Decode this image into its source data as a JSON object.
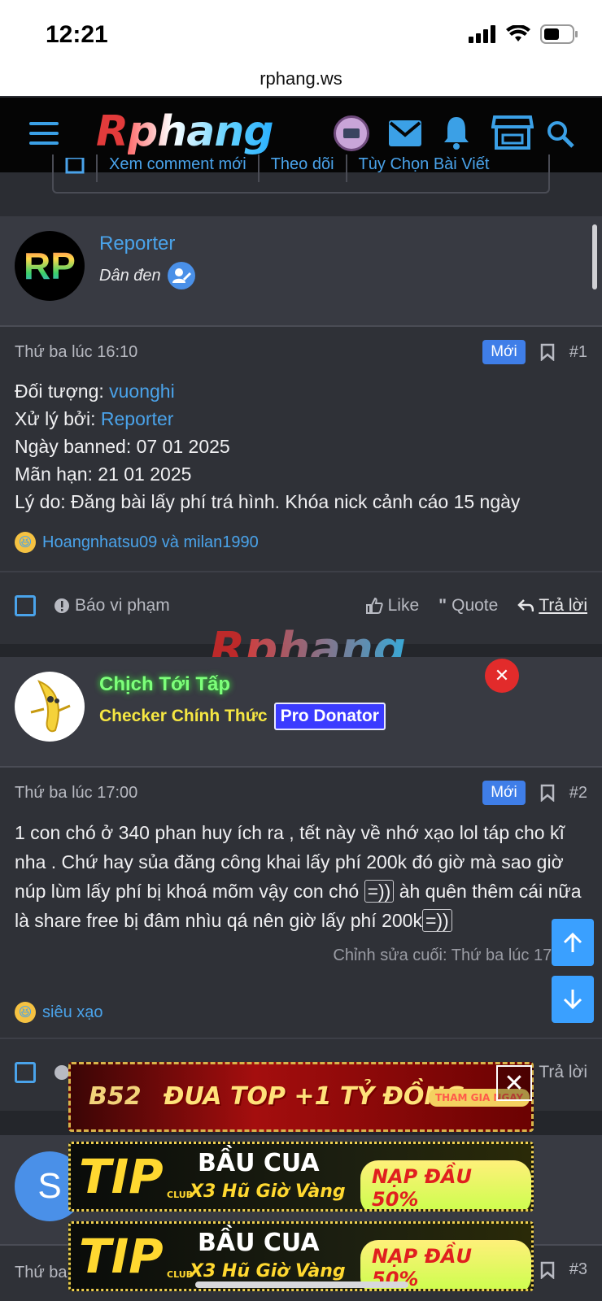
{
  "status_bar": {
    "time": "12:21",
    "url": "rphang.ws"
  },
  "header": {
    "logo_r": "R",
    "logo_rest": "phang",
    "watermark": "Rphang"
  },
  "subtoolbar": {
    "items": [
      "Xem comment mới",
      "Theo dõi",
      "Tùy Chọn Bài Viết"
    ]
  },
  "posts": [
    {
      "username": "Reporter",
      "user_title": "Dân đen",
      "avatar_text": "RP",
      "timestamp": "Thứ ba lúc 16:10",
      "new_badge": "Mới",
      "number": "#1",
      "lines": [
        {
          "label": "Đối tượng: ",
          "value": "vuonghi"
        },
        {
          "label": "Xử lý bởi: ",
          "value": "Reporter"
        },
        {
          "label": "Ngày banned: 07 01 2025",
          "value": ""
        },
        {
          "label": "Mãn hạn: 21 01 2025",
          "value": ""
        },
        {
          "label": "Lý do: Đăng bài lấy phí trá hình. Khóa nick cảnh cáo 15 ngày",
          "value": ""
        }
      ],
      "reactions": "Hoangnhatsu09 và milan1990"
    },
    {
      "username": "Chịch Tới Tấp",
      "user_title": "Checker Chính Thức",
      "user_badge": "Pro Donator",
      "timestamp": "Thứ ba lúc 17:00",
      "new_badge": "Mới",
      "number": "#2",
      "content_a": "1 con chó ở 340 phan huy ích ra , tết này về nhớ xạo lol táp cho kĩ nha . Chứ hay sủa đăng công khai lấy phí 200k đó giờ mà sao giờ núp lùm lấy phí bị khoá mõm vậy con chó ",
      "smiley": "=))",
      "content_b": " àh quên thêm cái nữa là share free bị đâm nhìu qá nên giờ lấy phí 200k",
      "edited": "Chỉnh sửa cuối: Thứ ba lúc 17:02",
      "reactions": "siêu xạo"
    },
    {
      "avatar_text": "S",
      "timestamp": "Thứ ba",
      "number": "#3"
    }
  ],
  "actions": {
    "report": "Báo vi phạm",
    "like": "Like",
    "quote": "Quote",
    "reply": "Trả lời"
  },
  "ads": {
    "b52": {
      "brand": "B52",
      "text": "ĐUA TOP +1 TỶ ĐỒNG",
      "cta": "THAM GIA NGAY"
    },
    "tip": {
      "brand": "TIP",
      "sub": "CLUB",
      "line1": "BẦU CUA",
      "line2": "X3 Hũ Giờ Vàng",
      "cta": "NẠP ĐẦU 50%"
    }
  },
  "colors": {
    "accent": "#4aa3ea",
    "badge_new": "#3f7ee8",
    "close_red": "#e22b2b",
    "title_yellow": "#f5e642",
    "name_green": "#7dff7a",
    "donator": "#3b3bff"
  }
}
